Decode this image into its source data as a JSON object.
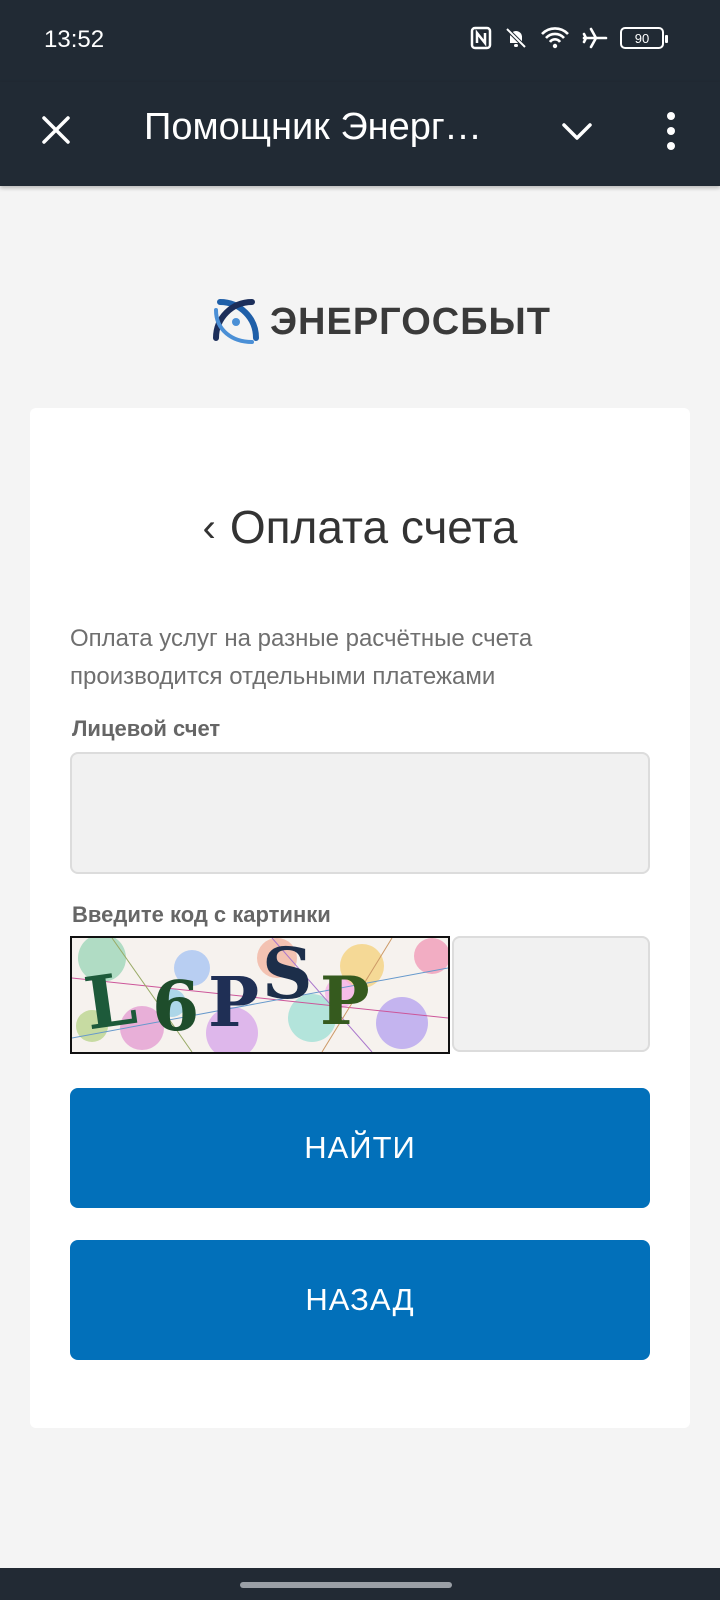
{
  "status_bar": {
    "time": "13:52",
    "icons": [
      "nfc-icon",
      "bell-muted-icon",
      "wifi-icon",
      "airplane-icon"
    ],
    "battery": "90"
  },
  "app_bar": {
    "title": "Помощник Энергосбыт",
    "close_icon": "close-icon",
    "collapse_icon": "chevron-down-icon",
    "menu_icon": "more-vertical-icon"
  },
  "brand": {
    "name": "ЭНЕРГОСБЫТ",
    "colors": {
      "blue": "#1f5fa8",
      "navy": "#1c2e5a",
      "text": "#3a3a3a"
    }
  },
  "form": {
    "back_symbol": "‹",
    "title": "Оплата счета",
    "note": "Оплата услуг на разные расчётные счета производится отдельными платежами",
    "account_label": "Лицевой счет",
    "account_value": "",
    "captcha_label": "Введите код с картинки",
    "captcha_text": [
      "L",
      "6",
      "P",
      "S",
      "P"
    ],
    "captcha_value": "",
    "find_button": "НАЙТИ",
    "back_button": "НАЗАД",
    "accent_color": "#0270ba"
  }
}
